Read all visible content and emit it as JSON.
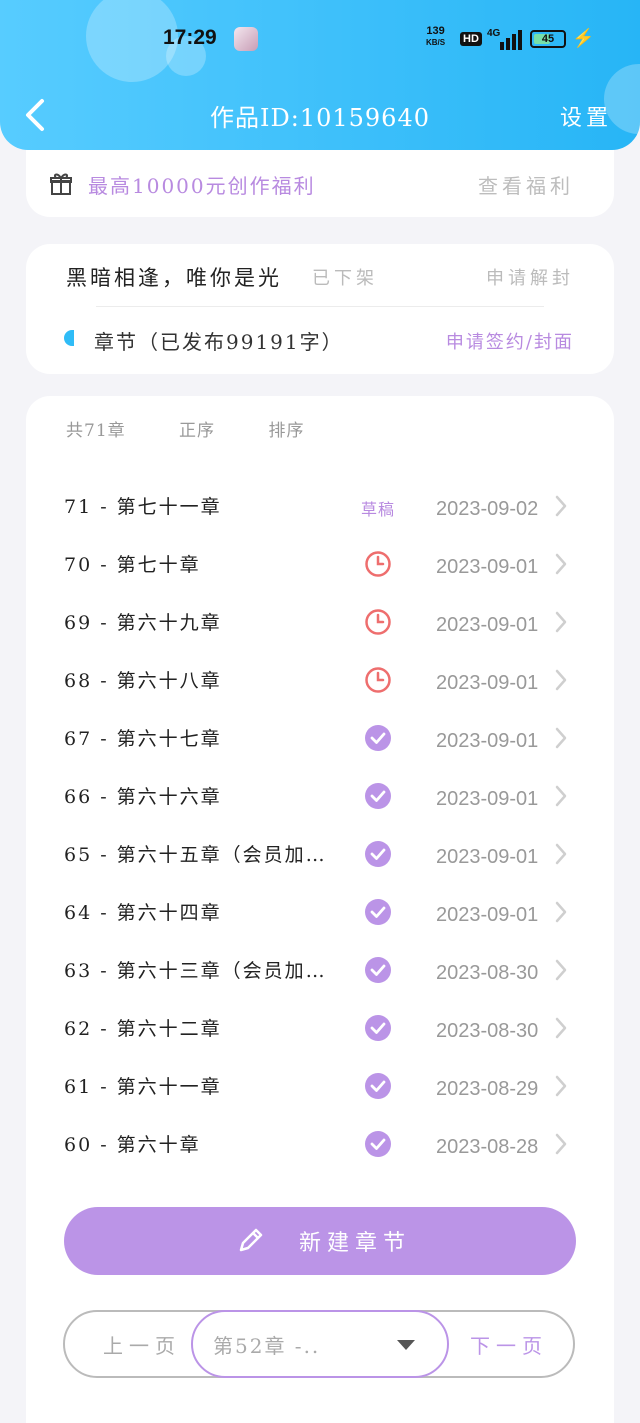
{
  "status_bar": {
    "time": "17:29",
    "net_speed_value": "139",
    "net_speed_unit": "KB/S",
    "hd_label": "HD",
    "signal_label": "4G",
    "battery": "45"
  },
  "header": {
    "title": "作品ID:10159640",
    "settings_label": "设置",
    "back_icon": "chevron-left-icon"
  },
  "benefit_bar": {
    "text": "最高10000元创作福利",
    "link": "查看福利",
    "icon": "gift-icon"
  },
  "work": {
    "name": "黑暗相逢，唯你是光",
    "status": "已下架",
    "unseal_label": "申请解封",
    "chapter_stat": "章节（已发布99191字）",
    "apply_label": "申请签约/封面"
  },
  "chapter_list": {
    "tabs": [
      "共71章",
      "正序",
      "排序"
    ],
    "rows": [
      {
        "name": "71 - 第七十一章",
        "status": "draft",
        "status_label": "草稿",
        "date": "2023-09-02"
      },
      {
        "name": "70 - 第七十章",
        "status": "scheduled",
        "status_label": "",
        "date": "2023-09-01"
      },
      {
        "name": "69 - 第六十九章",
        "status": "scheduled",
        "status_label": "",
        "date": "2023-09-01"
      },
      {
        "name": "68 - 第六十八章",
        "status": "scheduled",
        "status_label": "",
        "date": "2023-09-01"
      },
      {
        "name": "67 - 第六十七章",
        "status": "published",
        "status_label": "",
        "date": "2023-09-01"
      },
      {
        "name": "66 - 第六十六章",
        "status": "published",
        "status_label": "",
        "date": "2023-09-01"
      },
      {
        "name": "65 - 第六十五章（会员加…",
        "status": "published",
        "status_label": "",
        "date": "2023-09-01"
      },
      {
        "name": "64 - 第六十四章",
        "status": "published",
        "status_label": "",
        "date": "2023-09-01"
      },
      {
        "name": "63 - 第六十三章（会员加…",
        "status": "published",
        "status_label": "",
        "date": "2023-08-30"
      },
      {
        "name": "62 - 第六十二章",
        "status": "published",
        "status_label": "",
        "date": "2023-08-30"
      },
      {
        "name": "61 - 第六十一章",
        "status": "published",
        "status_label": "",
        "date": "2023-08-29"
      },
      {
        "name": "60 - 第六十章",
        "status": "published",
        "status_label": "",
        "date": "2023-08-28"
      }
    ]
  },
  "actions": {
    "new_chapter": "新建章节",
    "prev_page": "上一页",
    "current_page": "第52章 -..",
    "next_page": "下一页"
  },
  "colors": {
    "header": "#27b5f6",
    "accent": "#bb94e7",
    "scheduled_red": "#ee6e6e"
  }
}
